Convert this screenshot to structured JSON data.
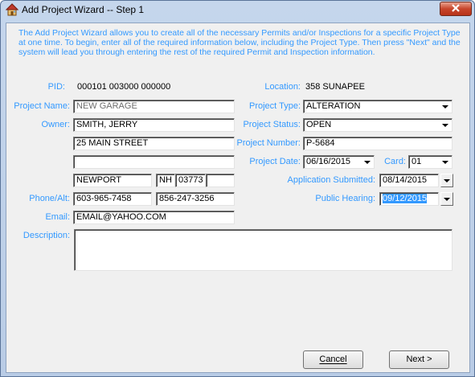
{
  "window": {
    "title": "Add Project Wizard -- Step 1"
  },
  "intro_text": "The Add Project Wizard allows you to create all of the necessary Permits and/or Inspections for a specific Project Type at one time.  To begin, enter all of the required information below, including the Project Type.  Then press \"Next\" and the system will lead you through entering the rest of the required Permit and Inspection information.",
  "form": {
    "pid_label": "PID:",
    "pid_value": "000101 003000 000000",
    "location_label": "Location:",
    "location_value": "358 SUNAPEE",
    "project_name_label": "Project Name:",
    "project_name_value": "NEW GARAGE",
    "project_type_label": "Project Type:",
    "project_type_value": "ALTERATION",
    "owner_label": "Owner:",
    "owner_value": "SMITH, JERRY",
    "project_status_label": "Project Status:",
    "project_status_value": "OPEN",
    "address1_value": "25 MAIN STREET",
    "project_number_label": "Project Number:",
    "project_number_value": "P-5684",
    "address2_value": "",
    "project_date_label": "Project Date:",
    "project_date_value": "06/16/2015",
    "card_label": "Card:",
    "card_value": "01",
    "city_value": "NEWPORT",
    "state_value": "NH",
    "zip_value": "03773",
    "zip4_value": "",
    "application_submitted_label": "Application Submitted:",
    "application_submitted_value": "08/14/2015",
    "phone_label": "Phone/Alt:",
    "phone_value": "603-965-7458",
    "alt_phone_value": "856-247-3256",
    "public_hearing_label": "Public Hearing:",
    "public_hearing_value": "09/12/2015",
    "email_label": "Email:",
    "email_value": "EMAIL@YAHOO.COM",
    "description_label": "Description:",
    "description_value": ""
  },
  "buttons": {
    "cancel_label": "Cancel",
    "next_label": "Next >"
  },
  "icons": {
    "title_icon": "house-icon",
    "close_icon": "close-icon"
  },
  "colors": {
    "label_blue": "#3399ff",
    "close_red": "#c7452b",
    "selection_blue": "#3399ff"
  }
}
